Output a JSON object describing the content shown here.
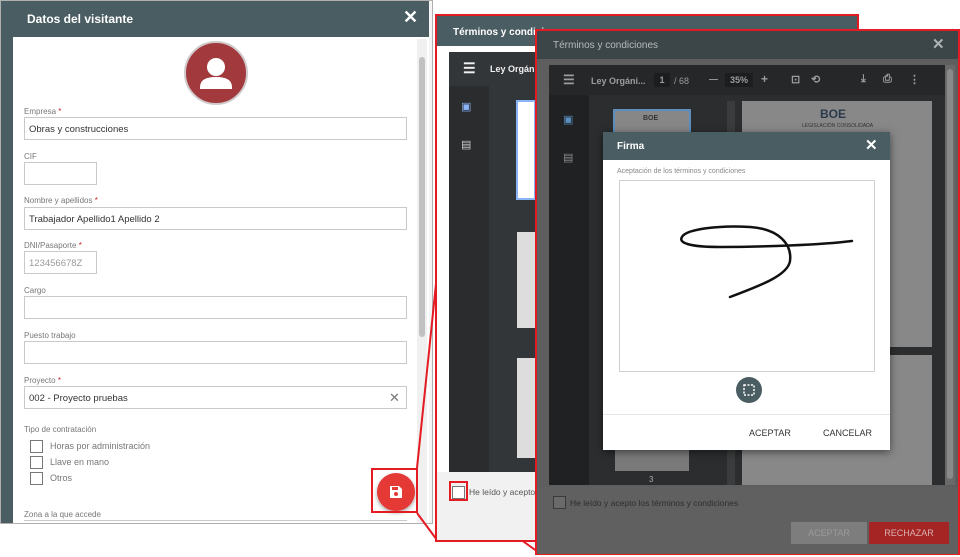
{
  "visitor_form": {
    "title": "Datos del visitante",
    "close_icon": "close-icon",
    "avatar_icon": "user-icon",
    "fields": {
      "empresa": {
        "label": "Empresa",
        "value": "Obras y construcciones"
      },
      "cif": {
        "label": "CIF",
        "value": ""
      },
      "nombre": {
        "label": "Nombre y apellidos",
        "value": "Trabajador Apellido1 Apellido 2"
      },
      "dni": {
        "label": "DNI/Pasaporte",
        "value": "123456678Z"
      },
      "cargo": {
        "label": "Cargo",
        "value": ""
      },
      "puesto": {
        "label": "Puesto trabajo",
        "value": ""
      },
      "proyecto": {
        "label": "Proyecto",
        "value": "002 - Proyecto pruebas"
      }
    },
    "required_mark": "*",
    "contratacion": {
      "label": "Tipo de contratación",
      "options": [
        "Horas por administración",
        "Llave en mano",
        "Otros"
      ]
    },
    "zona_label": "Zona a la que accede",
    "save_icon": "save-icon"
  },
  "terms_panel": {
    "title": "Términos y condiciones",
    "doc_title": "Ley Orgáni...",
    "checkbox_label": "He leído y acepto l"
  },
  "terms_panel_front": {
    "title": "Términos y condiciones",
    "doc_title": "Ley Orgáni...",
    "page_current": "1",
    "page_total": "/ 68",
    "zoom": "35%",
    "zoom_out": "—",
    "zoom_in": "+",
    "thumb_page_number": "3",
    "boe_logo": "BOE",
    "boe_subtitle": "LEGISLACIÓN CONSOLIDADA",
    "checkbox_label": "He leído y acepto los términos y condiciones",
    "accept_label": "ACEPTAR",
    "reject_label": "RECHAZAR"
  },
  "signature_dialog": {
    "title": "Firma",
    "caption": "Aceptación de los términos y condiciones",
    "accept_label": "ACEPTAR",
    "cancel_label": "CANCELAR"
  },
  "colors": {
    "header": "#4a5d63",
    "avatar": "#a23a3d",
    "fab": "#e53935",
    "highlight": "#e31b23",
    "reject": "#c62828"
  }
}
